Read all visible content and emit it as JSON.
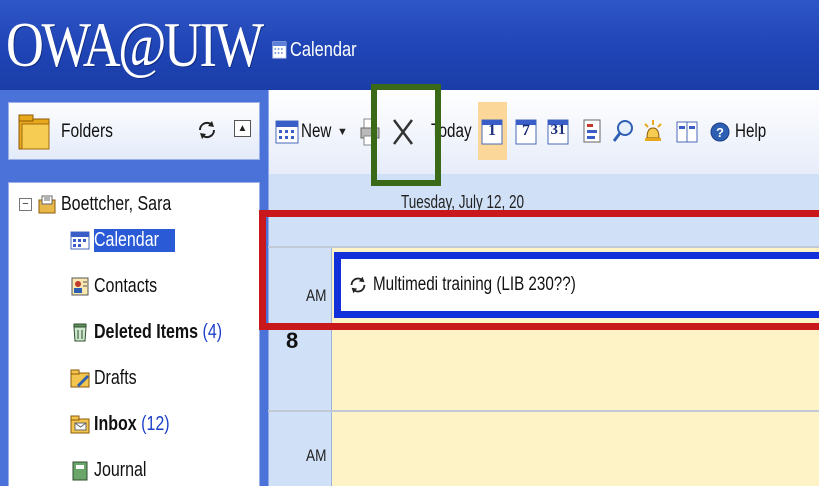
{
  "app": {
    "logo_text": "OWA@UIW",
    "module_title": "Calendar"
  },
  "sidebar": {
    "folders_label": "Folders",
    "tree": {
      "owner": "Boettcher, Sara",
      "items": [
        {
          "label": "Calendar",
          "count": "",
          "bold": false,
          "selected": true,
          "icon": "calendar-icon"
        },
        {
          "label": "Contacts",
          "count": "",
          "bold": false,
          "selected": false,
          "icon": "contacts-icon"
        },
        {
          "label": "Deleted Items",
          "count": "(4)",
          "bold": true,
          "selected": false,
          "icon": "trash-icon"
        },
        {
          "label": "Drafts",
          "count": "",
          "bold": false,
          "selected": false,
          "icon": "drafts-icon"
        },
        {
          "label": "Inbox",
          "count": "(12)",
          "bold": true,
          "selected": false,
          "icon": "inbox-icon"
        },
        {
          "label": "Journal",
          "count": "",
          "bold": false,
          "selected": false,
          "icon": "journal-icon"
        }
      ]
    }
  },
  "toolbar": {
    "new_label": "New",
    "today_label": "Today",
    "day_view": "1",
    "week_view": "7",
    "month_view": "31",
    "help_label": "Help"
  },
  "calendar": {
    "date_header": "Tuesday, July 12, 20",
    "am_label": "AM",
    "hour_label": "8",
    "appointment": "Multimedi training (LIB 230??)"
  },
  "colors": {
    "header_blue": "#2050c0",
    "highlight_red": "#c8181c",
    "highlight_green": "#3a6a18",
    "appointment_border": "#1230d9",
    "slot_yellow": "#fdf3c6"
  }
}
